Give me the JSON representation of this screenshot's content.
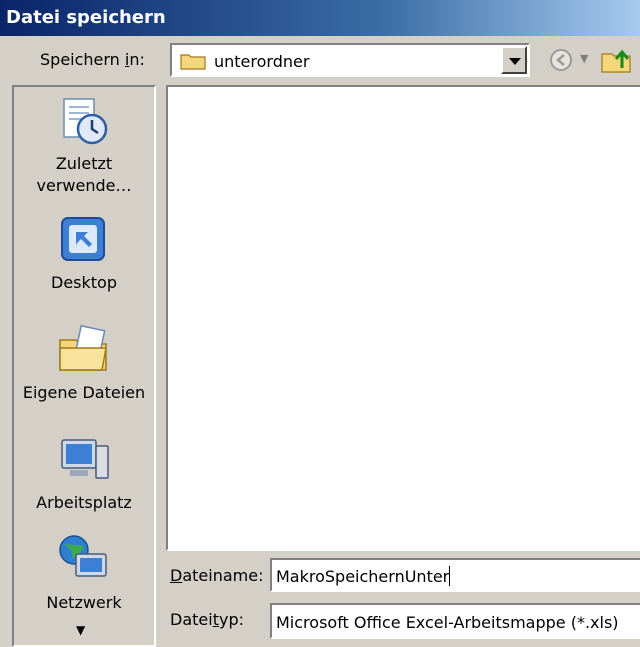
{
  "title": "Datei speichern",
  "save_in": {
    "label_pre": "Speichern ",
    "label_ul": "i",
    "label_post": "n:",
    "folder": "unterordner"
  },
  "places": [
    {
      "label": "Zuletzt verwende…",
      "icon": "recent-documents-icon"
    },
    {
      "label": "Desktop",
      "icon": "desktop-icon"
    },
    {
      "label": "Eigene Dateien",
      "icon": "my-documents-icon"
    },
    {
      "label": "Arbeitsplatz",
      "icon": "my-computer-icon"
    },
    {
      "label": "Netzwerk",
      "icon": "network-icon"
    }
  ],
  "filename": {
    "label_ul": "D",
    "label_post": "ateiname:",
    "value": "MakroSpeichernUnter"
  },
  "filetype": {
    "label_pre": "Datei",
    "label_ul": "t",
    "label_post": "yp:",
    "value": "Microsoft Office Excel-Arbeitsmappe (*.xls)"
  },
  "colors": {
    "titlebar_start": "#0a246a",
    "dialog_bg": "#d4d0c8"
  }
}
